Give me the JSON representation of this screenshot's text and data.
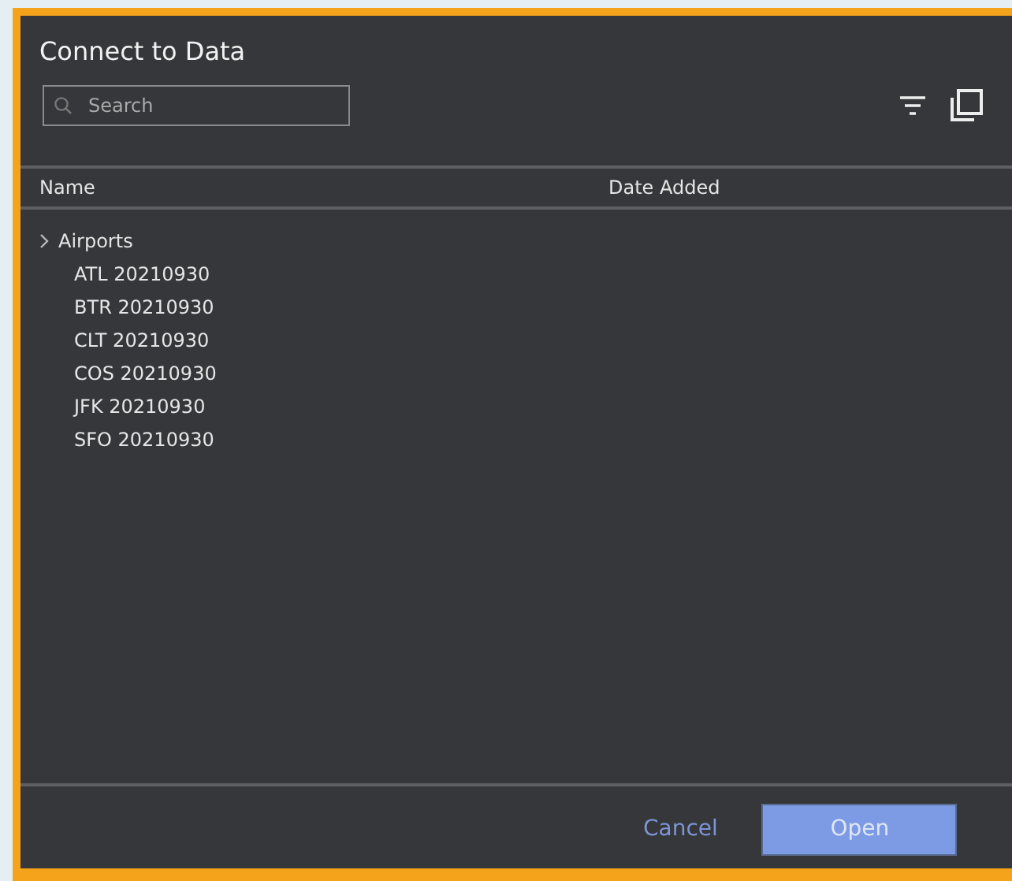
{
  "window": {
    "title": "Connect to Data"
  },
  "search": {
    "placeholder": "Search"
  },
  "table": {
    "columns": [
      "Name",
      "Date Added"
    ],
    "tree": [
      {
        "label": "Airports",
        "children": [
          {
            "label": "ATL 20210930"
          },
          {
            "label": "BTR 20210930"
          },
          {
            "label": "CLT 20210930"
          },
          {
            "label": "COS 20210930"
          },
          {
            "label": "JFK 20210930"
          },
          {
            "label": "SFO 20210930"
          }
        ]
      }
    ]
  },
  "buttons": [
    {
      "label": "Cancel",
      "kind": "link"
    },
    {
      "label": "Open",
      "kind": "primary"
    }
  ]
}
